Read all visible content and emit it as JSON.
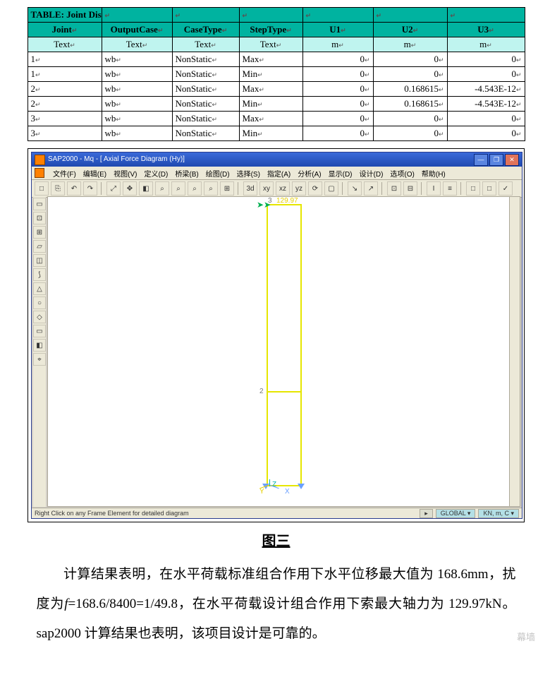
{
  "table": {
    "title": "TABLE:  Joint Displacements",
    "headers": [
      "Joint",
      "OutputCase",
      "CaseType",
      "StepType",
      "U1",
      "U2",
      "U3"
    ],
    "units": [
      "Text",
      "Text",
      "Text",
      "Text",
      "m",
      "m",
      "m"
    ],
    "rows": [
      {
        "joint": "1",
        "case": "wb",
        "ctype": "NonStatic",
        "step": "Max",
        "u1": "0",
        "u2": "0",
        "u3": "0"
      },
      {
        "joint": "1",
        "case": "wb",
        "ctype": "NonStatic",
        "step": "Min",
        "u1": "0",
        "u2": "0",
        "u3": "0"
      },
      {
        "joint": "2",
        "case": "wb",
        "ctype": "NonStatic",
        "step": "Max",
        "u1": "0",
        "u2": "0.168615",
        "u3": "-4.543E-12"
      },
      {
        "joint": "2",
        "case": "wb",
        "ctype": "NonStatic",
        "step": "Min",
        "u1": "0",
        "u2": "0.168615",
        "u3": "-4.543E-12"
      },
      {
        "joint": "3",
        "case": "wb",
        "ctype": "NonStatic",
        "step": "Max",
        "u1": "0",
        "u2": "0",
        "u3": "0"
      },
      {
        "joint": "3",
        "case": "wb",
        "ctype": "NonStatic",
        "step": "Min",
        "u1": "0",
        "u2": "0",
        "u3": "0"
      }
    ]
  },
  "sap": {
    "title": "SAP2000 - Mq - [ Axial Force Diagram   (Hy)]",
    "menu": [
      "文件(F)",
      "编辑(E)",
      "视图(V)",
      "定义(D)",
      "桥梁(B)",
      "绘图(D)",
      "选择(S)",
      "指定(A)",
      "分析(A)",
      "显示(D)",
      "设计(D)",
      "选项(O)",
      "帮助(H)"
    ],
    "joint3": "3",
    "force": "129.97",
    "joint2": "2",
    "axes": {
      "x": "X",
      "y": "Y",
      "z": "Z"
    },
    "status_left": "Right Click on any Frame Element for detailed diagram",
    "status_combo1": "GLOBAL",
    "status_combo2": "KN, m, C",
    "win_btns": {
      "min": "—",
      "max": "❐",
      "close": "✕"
    },
    "toolbar_glyphs": [
      "□",
      "⎘",
      "↶",
      "↷",
      "|",
      "⤢",
      "✥",
      "◧",
      "⌕",
      "⌕",
      "⌕",
      "⌕",
      "⊞",
      "|",
      "3d",
      "xy",
      "xz",
      "yz",
      "⟳",
      "▢",
      "|",
      "↘",
      "↗",
      "|",
      "⊡",
      "⊟",
      "|",
      "I",
      "≡",
      "|",
      "□",
      "□",
      "✓"
    ],
    "left_toolbox_glyphs": [
      "▭",
      "⊡",
      "⊞",
      "▱",
      "◫",
      "⟆",
      "△",
      "○",
      "◇",
      "▭",
      "◧",
      "⌖"
    ]
  },
  "caption": "图三",
  "paragraph": {
    "t1": "计算结果表明，在水平荷载标准组合作用下水平位移最大值为",
    "t2": "168.6mm，扰度为",
    "t3": "f",
    "t4": "=168.6/8400=1/49.8，在水平荷载设计组合作用下索最大轴力为 129.97kN。sap2000 计算结果也表明，该项目设计是可靠的。"
  },
  "watermark": "幕墙"
}
